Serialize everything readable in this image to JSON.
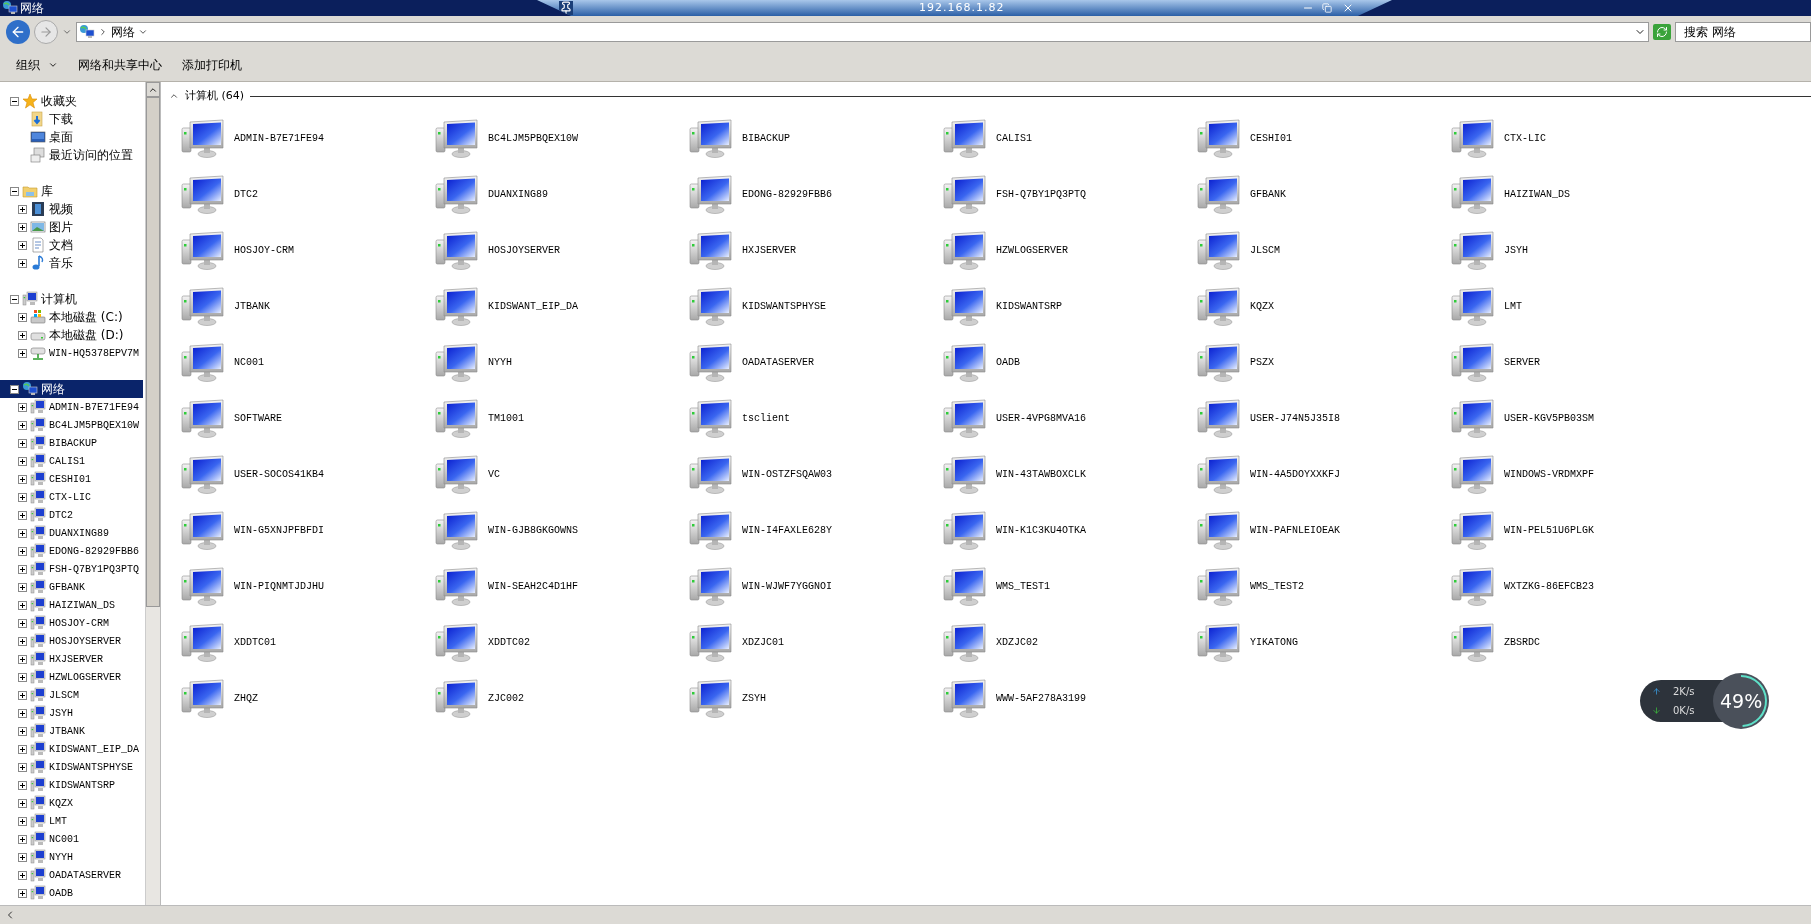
{
  "window": {
    "title": "网络"
  },
  "remote_bar": {
    "title": "192.168.1.82"
  },
  "address_bar": {
    "breadcrumb": "网络"
  },
  "search": {
    "placeholder": "搜索 网络"
  },
  "toolbar": [
    {
      "label": "组织",
      "kind": "menu"
    },
    {
      "label": "网络和共享中心",
      "kind": "button"
    },
    {
      "label": "添加打印机",
      "kind": "button"
    }
  ],
  "sidebar": [
    {
      "label": "收藏夹",
      "kind": "star",
      "expanded": true,
      "selected": false,
      "children": [
        {
          "label": "下载",
          "kind": "download"
        },
        {
          "label": "桌面",
          "kind": "desktop"
        },
        {
          "label": "最近访问的位置",
          "kind": "recent"
        }
      ]
    },
    {
      "label": "库",
      "kind": "library",
      "expanded": true,
      "selected": false,
      "children": [
        {
          "label": "视频",
          "kind": "video",
          "expanded": false
        },
        {
          "label": "图片",
          "kind": "picture",
          "expanded": false
        },
        {
          "label": "文档",
          "kind": "document",
          "expanded": false
        },
        {
          "label": "音乐",
          "kind": "music",
          "expanded": false
        }
      ]
    },
    {
      "label": "计算机",
      "kind": "computer",
      "expanded": true,
      "selected": false,
      "children": [
        {
          "label": "本地磁盘 (C:)",
          "kind": "system-drive",
          "expanded": false
        },
        {
          "label": "本地磁盘 (D:)",
          "kind": "drive",
          "expanded": false
        },
        {
          "label": "WIN-HQ5378EPV7M",
          "kind": "network-drive",
          "expanded": false
        }
      ]
    },
    {
      "label": "网络",
      "kind": "network",
      "expanded": true,
      "selected": true,
      "children": [
        {
          "label": "ADMIN-B7E71FE94",
          "kind": "computer",
          "expanded": false
        },
        {
          "label": "BC4LJM5PBQEX10W",
          "kind": "computer",
          "expanded": false
        },
        {
          "label": "BIBACKUP",
          "kind": "computer",
          "expanded": false
        },
        {
          "label": "CALIS1",
          "kind": "computer",
          "expanded": false
        },
        {
          "label": "CESHI01",
          "kind": "computer",
          "expanded": false
        },
        {
          "label": "CTX-LIC",
          "kind": "computer",
          "expanded": false
        },
        {
          "label": "DTC2",
          "kind": "computer",
          "expanded": false
        },
        {
          "label": "DUANXING89",
          "kind": "computer",
          "expanded": false
        },
        {
          "label": "EDONG-82929FBB6",
          "kind": "computer",
          "expanded": false
        },
        {
          "label": "FSH-Q7BY1PQ3PTQ",
          "kind": "computer",
          "expanded": false
        },
        {
          "label": "GFBANK",
          "kind": "computer",
          "expanded": false
        },
        {
          "label": "HAIZIWAN_DS",
          "kind": "computer",
          "expanded": false
        },
        {
          "label": "HOSJOY-CRM",
          "kind": "computer",
          "expanded": false
        },
        {
          "label": "HOSJOYSERVER",
          "kind": "computer",
          "expanded": false
        },
        {
          "label": "HXJSERVER",
          "kind": "computer",
          "expanded": false
        },
        {
          "label": "HZWLOGSERVER",
          "kind": "computer",
          "expanded": false
        },
        {
          "label": "JLSCM",
          "kind": "computer",
          "expanded": false
        },
        {
          "label": "JSYH",
          "kind": "computer",
          "expanded": false
        },
        {
          "label": "JTBANK",
          "kind": "computer",
          "expanded": false
        },
        {
          "label": "KIDSWANT_EIP_DA",
          "kind": "computer",
          "expanded": false
        },
        {
          "label": "KIDSWANTSPHYSE",
          "kind": "computer",
          "expanded": false
        },
        {
          "label": "KIDSWANTSRP",
          "kind": "computer",
          "expanded": false
        },
        {
          "label": "KQZX",
          "kind": "computer",
          "expanded": false
        },
        {
          "label": "LMT",
          "kind": "computer",
          "expanded": false
        },
        {
          "label": "NC001",
          "kind": "computer",
          "expanded": false
        },
        {
          "label": "NYYH",
          "kind": "computer",
          "expanded": false
        },
        {
          "label": "OADATASERVER",
          "kind": "computer",
          "expanded": false
        },
        {
          "label": "OADB",
          "kind": "computer",
          "expanded": false
        }
      ]
    }
  ],
  "content": {
    "group_header": "计算机 (64)",
    "computers": [
      "ADMIN-B7E71FE94",
      "BC4LJM5PBQEX10W",
      "BIBACKUP",
      "CALIS1",
      "CESHI01",
      "CTX-LIC",
      "DTC2",
      "DUANXING89",
      "EDONG-82929FBB6",
      "FSH-Q7BY1PQ3PTQ",
      "GFBANK",
      "HAIZIWAN_DS",
      "HOSJOY-CRM",
      "HOSJOYSERVER",
      "HXJSERVER",
      "HZWLOGSERVER",
      "JLSCM",
      "JSYH",
      "JTBANK",
      "KIDSWANT_EIP_DA",
      "KIDSWANTSPHYSE",
      "KIDSWANTSRP",
      "KQZX",
      "LMT",
      "NC001",
      "NYYH",
      "OADATASERVER",
      "OADB",
      "PSZX",
      "SERVER",
      "SOFTWARE",
      "TM1001",
      "tsclient",
      "USER-4VPG8MVA16",
      "USER-J74N5J35I8",
      "USER-KGV5PB03SM",
      "USER-SOCOS41KB4",
      "VC",
      "WIN-OSTZFSQAW03",
      "WIN-43TAWBOXCLK",
      "WIN-4A5DOYXXKFJ",
      "WINDOWS-VRDMXPF",
      "WIN-G5XNJPFBFDI",
      "WIN-GJB8GKGOWNS",
      "WIN-I4FAXLE628Y",
      "WIN-K1C3KU4OTKA",
      "WIN-PAFNLEIOEAK",
      "WIN-PEL51U6PLGK",
      "WIN-PIQNMTJDJHU",
      "WIN-SEAH2C4D1HF",
      "WIN-WJWF7YGGNOI",
      "WMS_TEST1",
      "WMS_TEST2",
      "WXTZKG-86EFCB23",
      "XDDTC01",
      "XDDTC02",
      "XDZJC01",
      "XDZJC02",
      "YIKATONG",
      "ZBSRDC",
      "ZHQZ",
      "ZJC002",
      "ZSYH",
      "WWW-5AF278A3199"
    ]
  },
  "speed_widget": {
    "upload": "2K/s",
    "download": "0K/s",
    "percent": "49%",
    "level": 0.49
  }
}
